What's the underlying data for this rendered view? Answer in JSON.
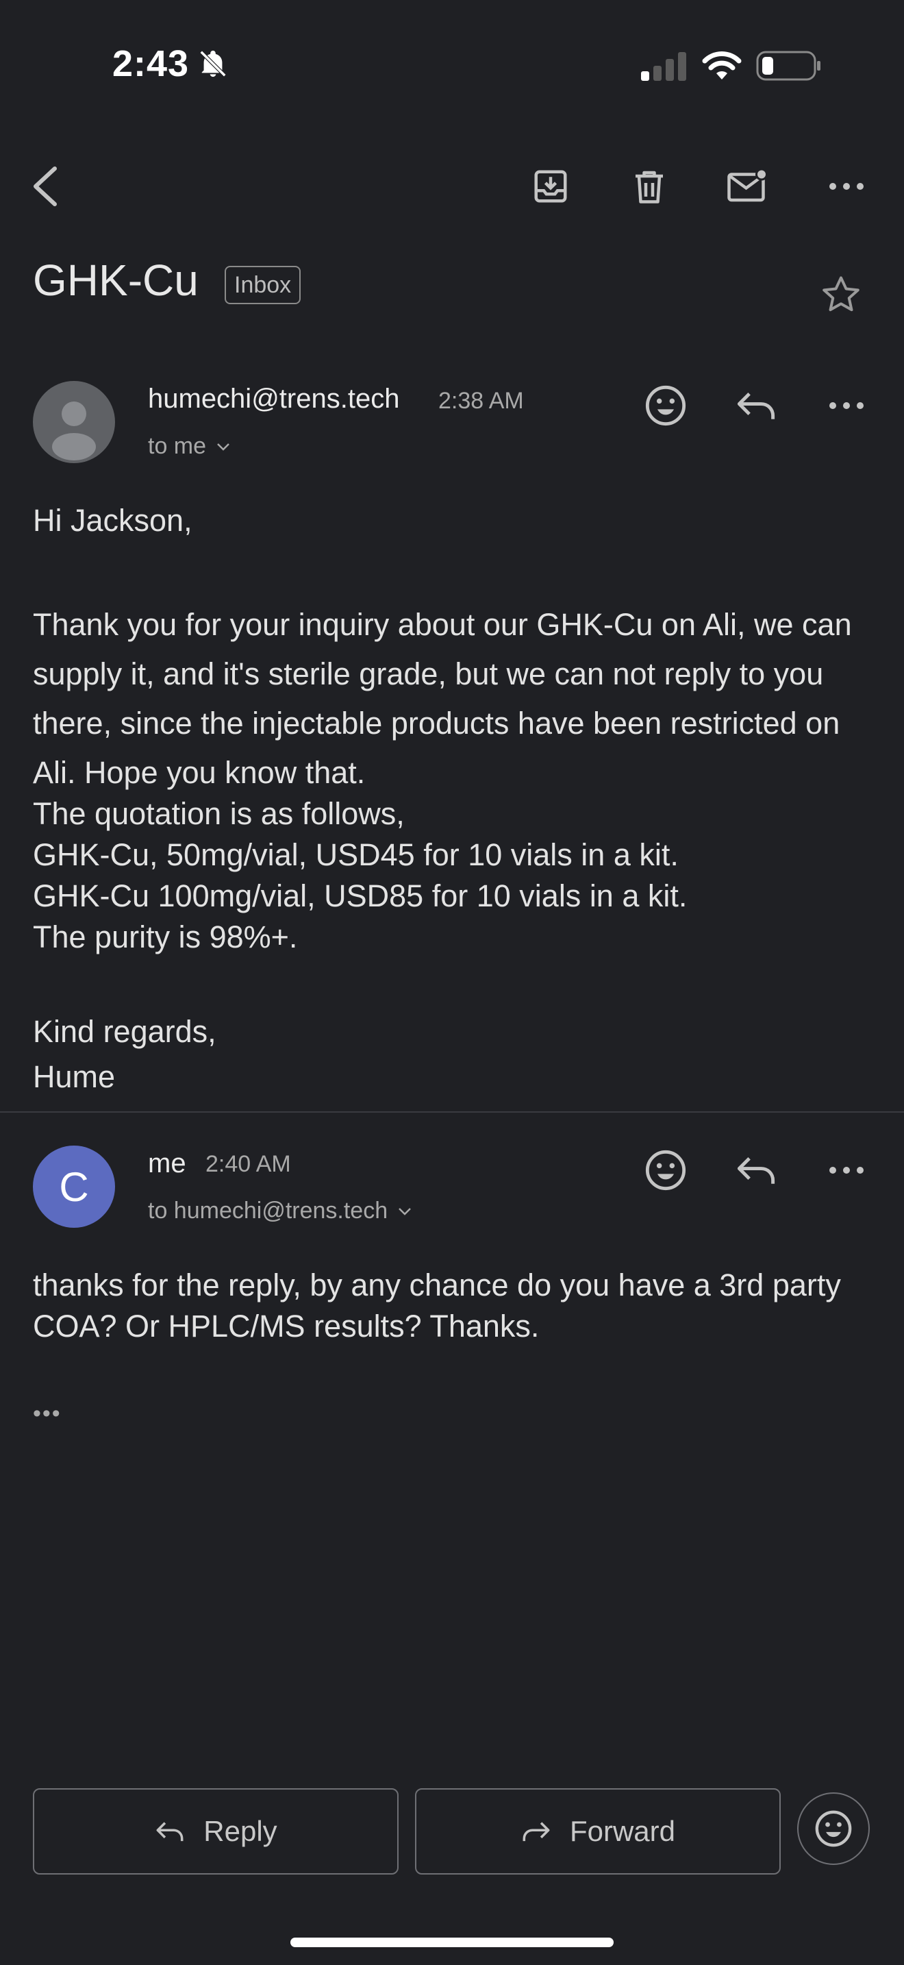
{
  "status_bar": {
    "time": "2:43"
  },
  "email": {
    "subject": "GHK-Cu",
    "label": "Inbox"
  },
  "messages": [
    {
      "sender": "humechi@trens.tech",
      "time": "2:38 AM",
      "recipient": "to me",
      "paragraphs": [
        "Hi Jackson,",
        "Thank you for your inquiry about our GHK-Cu on Ali, we can supply it, and it's sterile grade, but we can not reply to you there, since the injectable products have been restricted on Ali. Hope you know that.",
        "The quotation is as follows,",
        "GHK-Cu, 50mg/vial, USD45 for 10 vials in a kit.",
        "GHK-Cu 100mg/vial, USD85 for 10 vials in a kit.",
        "The purity is 98%+.",
        "Kind regards,",
        "Hume"
      ]
    },
    {
      "sender": "me",
      "avatar_letter": "C",
      "time": "2:40 AM",
      "recipient": "to humechi@trens.tech",
      "paragraphs": [
        "thanks for the reply, by any chance do you have a 3rd party COA? Or HPLC/MS results? Thanks."
      ],
      "trimmed_indicator": "•••"
    }
  ],
  "actions": {
    "reply_label": "Reply",
    "forward_label": "Forward"
  },
  "icons": {
    "toolbar": [
      "back-icon",
      "archive-icon",
      "trash-icon",
      "mark-unread-icon",
      "more-icon"
    ],
    "message": [
      "emoji-icon",
      "reply-icon",
      "more-icon"
    ]
  },
  "colors": {
    "background": "#1f2024",
    "avatar_me": "#5c6bc0",
    "avatar_default": "#5f6165"
  }
}
